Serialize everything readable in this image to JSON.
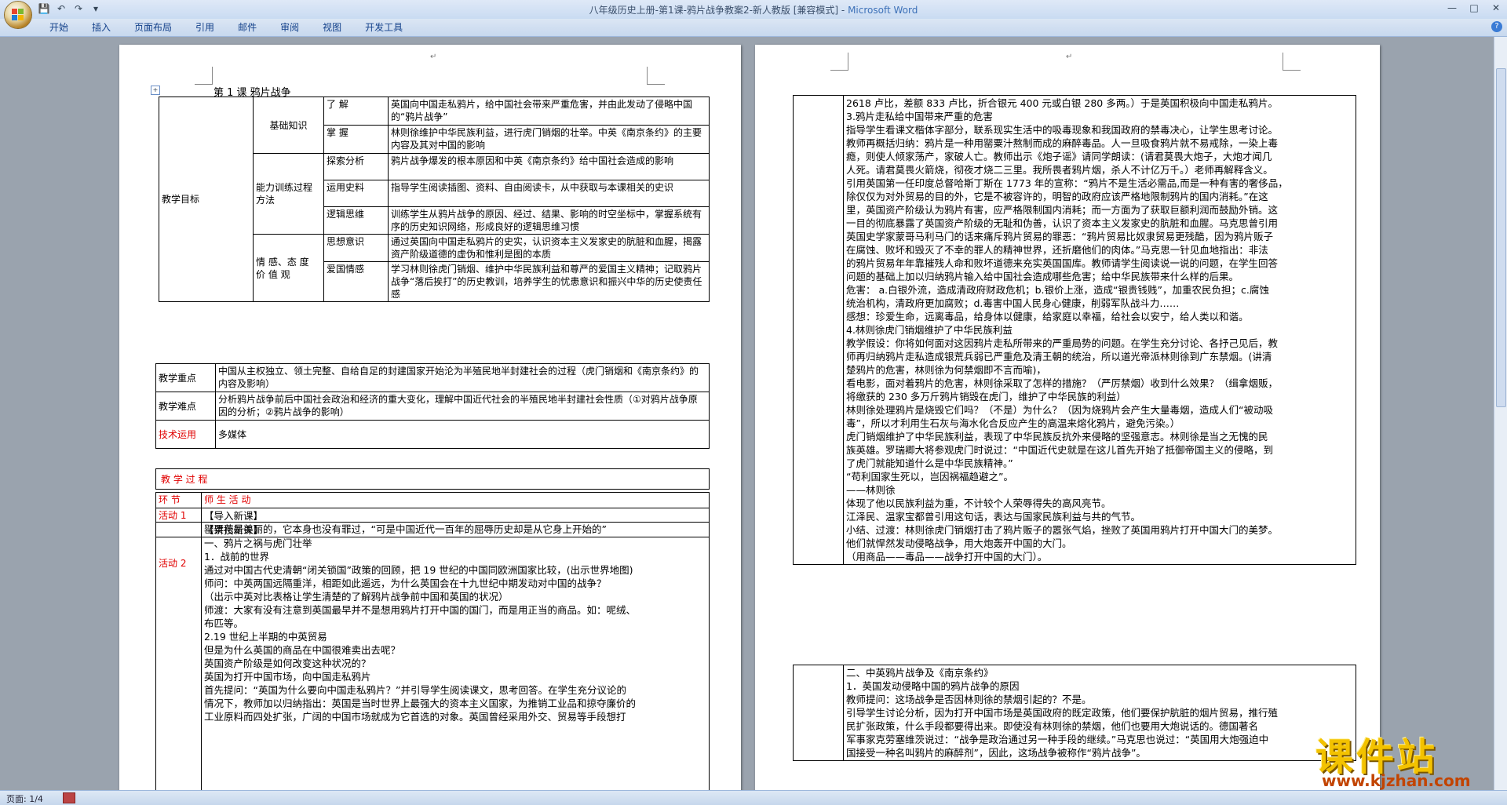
{
  "window": {
    "title_doc": "八年级历史上册-第1课-鸦片战争教案2-新人教版 [兼容模式] - ",
    "title_app": "Microsoft Word"
  },
  "quick_access": [
    "save-icon",
    "undo-icon",
    "redo-icon",
    "customize-icon"
  ],
  "ribbon": {
    "tabs": [
      "开始",
      "插入",
      "页面布局",
      "引用",
      "邮件",
      "审阅",
      "视图",
      "开发工具"
    ],
    "help": "?"
  },
  "page1": {
    "title": "第 1 课    鸦片战争",
    "goals": {
      "label": "教学目标",
      "groups": {
        "basic": "基础知识",
        "ability": "能力训练过程方法",
        "emotion": "情 感、态 度 价 值 观"
      },
      "rows": [
        {
          "k": "了    解",
          "v": "英国向中国走私鸦片，给中国社会带来严重危害，并由此发动了侵略中国的“鸦片战争”"
        },
        {
          "k": "掌    握",
          "v": "林则徐维护中华民族利益，进行虎门销烟的壮举。中英《南京条约》的主要内容及其对中国的影响"
        },
        {
          "k": "探索分析",
          "v": "鸦片战争爆发的根本原因和中英《南京条约》给中国社会造成的影响"
        },
        {
          "k": "运用史料",
          "v": "指导学生阅读插图、资料、自由阅读卡，从中获取与本课相关的史识"
        },
        {
          "k": "逻辑思维",
          "v": "训练学生从鸦片战争的原因、经过、结果、影响的时空坐标中，掌握系统有序的历史知识网络，形成良好的逻辑思维习惯"
        },
        {
          "k": "思想意识",
          "v": "通过英国向中国走私鸦片的史实，认识资本主义发家史的肮脏和血腥，揭露资产阶级道德的虚伪和惟利是图的本质"
        },
        {
          "k": "爱国情感",
          "v": "学习林则徐虎门销烟、维护中华民族利益和尊严的爱国主义精神；记取鸦片战争“落后挨打”的历史教训，培养学生的忧患意识和振兴中华的历史使责任感"
        }
      ]
    },
    "key_points": {
      "label": "教学重点",
      "v": "中国从主权独立、领土完整、自给自足的封建国家开始沦为半殖民地半封建社会的过程（虎门销烟和《南京条约》的内容及影响）"
    },
    "difficulties": {
      "label": "教学难点",
      "v": "分析鸦片战争前后中国社会政治和经济的重大变化，理解中国近代社会的半殖民地半封建社会性质（①对鸦片战争原因的分析；②鸦片战争的影响）"
    },
    "tech": {
      "label": "技术运用",
      "v": "多媒体"
    },
    "process_title": "教  学  过  程",
    "header": {
      "col1": "环  节",
      "col2": "师    生    活    动"
    },
    "activity1": {
      "label": "活动 1",
      "lines": [
        "【导入新课】",
        "罂粟花是美丽的，它本身也没有罪过，“可是中国近代一百年的屈辱历史却是从它身上开始的”"
      ]
    },
    "activity2": {
      "label": "活动 2",
      "lines": [
        "【讲授新课】",
        "一、鸦片之祸与虎门壮举",
        "1．战前的世界",
        "通过对中国古代史清朝“闭关锁国”政策的回顾，把 19 世纪的中国同欧洲国家比较，(出示世界地图)",
        "师问：中英两国远隔重洋，相距如此遥远，为什么英国会在十九世纪中期发动对中国的战争？",
        "（出示中英对比表格让学生清楚的了解鸦片战争前中国和英国的状况）",
        "师渡：大家有没有注意到英国最早并不是想用鸦片打开中国的国门，而是用正当的商品。如：呢绒、",
        "布匹等。",
        "2.19 世纪上半期的中英贸易",
        "但是为什么英国的商品在中国很难卖出去呢？",
        "英国资产阶级是如何改变这种状况的？",
        "英国为打开中国市场，向中国走私鸦片",
        "首先提问：“英国为什么要向中国走私鸦片？”并引导学生阅读课文，思考回答。在学生充分议论的",
        "情况下，教师加以归纳指出：英国是当时世界上最强大的资本主义国家，为推销工业品和掠夺廉价的",
        "工业原料而四处扩张，广阔的中国市场就成为它首选的对象。英国曾经采用外交、贸易等手段想打"
      ]
    }
  },
  "page2": {
    "block1_lines": [
      "2618 卢比，差额 833 卢比，折合银元 400 元或白银 280 多两。）于是英国积极向中国走私鸦片。",
      "3.鸦片走私给中国带来严重的危害",
      "指导学生看课文楷体字部分，联系现实生活中的吸毒现象和我国政府的禁毒决心，让学生思考讨论。",
      "教师再概括归纳：鸦片是一种用罂粟汁熬制而成的麻醉毒品。人一旦吸食鸦片就不易戒除，一染上毒",
      "瘾，则使人倾家荡产，家破人亡。教师出示《炮子谣》请同学朗读：(请君莫畏大炮子，大炮才闻几",
      "人死。请君莫畏火箭烧，彻夜才烧二三里。我所畏者鸦片烟，杀人不计亿万千。）老师再解释含义。",
      "引用英国第一任印度总督哈斯丁斯在 1773 年的宣称：“鸦片不是生活必需品,而是一种有害的奢侈品，",
      "除仅仅为对外贸易的目的外，它是不被容许的，明智的政府应该严格地限制鸦片的国内消耗。”在这",
      "里，英国资产阶级认为鸦片有害，应严格限制国内消耗；而一方面为了获取巨额利润而鼓励外销。这",
      "一目的彻底暴露了英国资产阶级的无耻和伪善，认识了资本主义发家史的肮脏和血腥。马克思曾引用",
      "英国史学家蒙哥马利马门的话来痛斥鸦片贸易的罪恶：“鸦片贸易比奴隶贸易更残酷，因为鸦片贩子",
      "在腐蚀、败坏和毁灭了不幸的罪人的精神世界，还折磨他们的肉体。”马克思一针见血地指出：非法",
      "的鸦片贸易年年靠摧残人命和败坏道德来充实英国国库。教师请学生阅读说一说的问题，在学生回答",
      "问题的基础上加以归纳鸦片输入给中国社会造成哪些危害；给中华民族带来什么样的后果。",
      "危害：  a.白银外流，造成清政府财政危机；b.银价上涨，造成“银贵钱贱”，加重农民负担；c.腐蚀",
      "统治机构，清政府更加腐败；d.毒害中国人民身心健康，削弱军队战斗力……",
      "感想：珍爱生命，远离毒品，给身体以健康，给家庭以幸福，给社会以安宁，给人类以和谐。",
      "4.林则徐虎门销烟维护了中华民族利益",
      "教学假设：你将如何面对这因鸦片走私所带来的严重局势的问题。在学生充分讨论、各抒己见后，教",
      "师再归纳鸦片走私造成银荒兵弱已严重危及清王朝的统治，所以道光帝派林则徐到广东禁烟。(讲清",
      "楚鸦片的危害，林则徐为何禁烟即不言而喻)，",
      "看电影，面对着鸦片的危害，林则徐采取了怎样的措施？（严厉禁烟）收到什么效果？（缉拿烟贩，",
      "将缴获的 230 多万斤鸦片销毁在虎门，维护了中华民族的利益）",
      "林则徐处理鸦片是烧毁它们吗？（不是）为什么？（因为烧鸦片会产生大量毒烟，造成人们“被动吸",
      "毒”，所以才利用生石灰与海水化合反应产生的高温来熔化鸦片，避免污染。）",
      "虎门销烟维护了中华民族利益，表现了中华民族反抗外来侵略的坚强意志。林则徐是当之无愧的民",
      "族英雄。罗瑞卿大将参观虎门时说过：“中国近代史就是在这儿首先开始了抵御帝国主义的侵略，到",
      "了虎门就能知道什么是中华民族精神。”",
      " “苟利国家生死以，岂因祸福趋避之”。",
      "                                  ——林则徐",
      "体现了他以民族利益为重，不计较个人荣辱得失的高风亮节。",
      "江泽民、温家宝都曾引用这句话，表达与国家民族利益与共的气节。",
      "小结、过渡：林则徐虎门销烟打击了鸦片贩子的嚣张气焰，挫败了英国用鸦片打开中国大门的美梦。",
      "他们就悍然发动侵略战争，用大炮轰开中国的大门。",
      "（用商品——毒品——战争打开中国的大门）。"
    ],
    "block2_lines": [
      "二、中英鸦片战争及《南京条约》",
      "1．英国发动侵略中国的鸦片战争的原因",
      "教师提问：这场战争是否因林则徐的禁烟引起的？不是。",
      "引导学生讨论分析，因为打开中国市场是英国政府的既定政策，他们要保护肮脏的烟片贸易，推行殖",
      "民扩张政策，什么手段都要得出来。即使没有林则徐的禁烟，他们也要用大炮说话的。德国著名",
      "军事家克劳塞维茨说过：“战争是政治通过另一种手段的继续。”马克思也说过：“英国用大炮强迫中",
      "国接受一种名叫鸦片的麻醉剂”，因此，这场战争被称作“鸦片战争”。"
    ]
  },
  "status": {
    "page": "页面: 1/4"
  },
  "watermark": {
    "cn": "课件站",
    "url": "www.kjzhan.com"
  }
}
